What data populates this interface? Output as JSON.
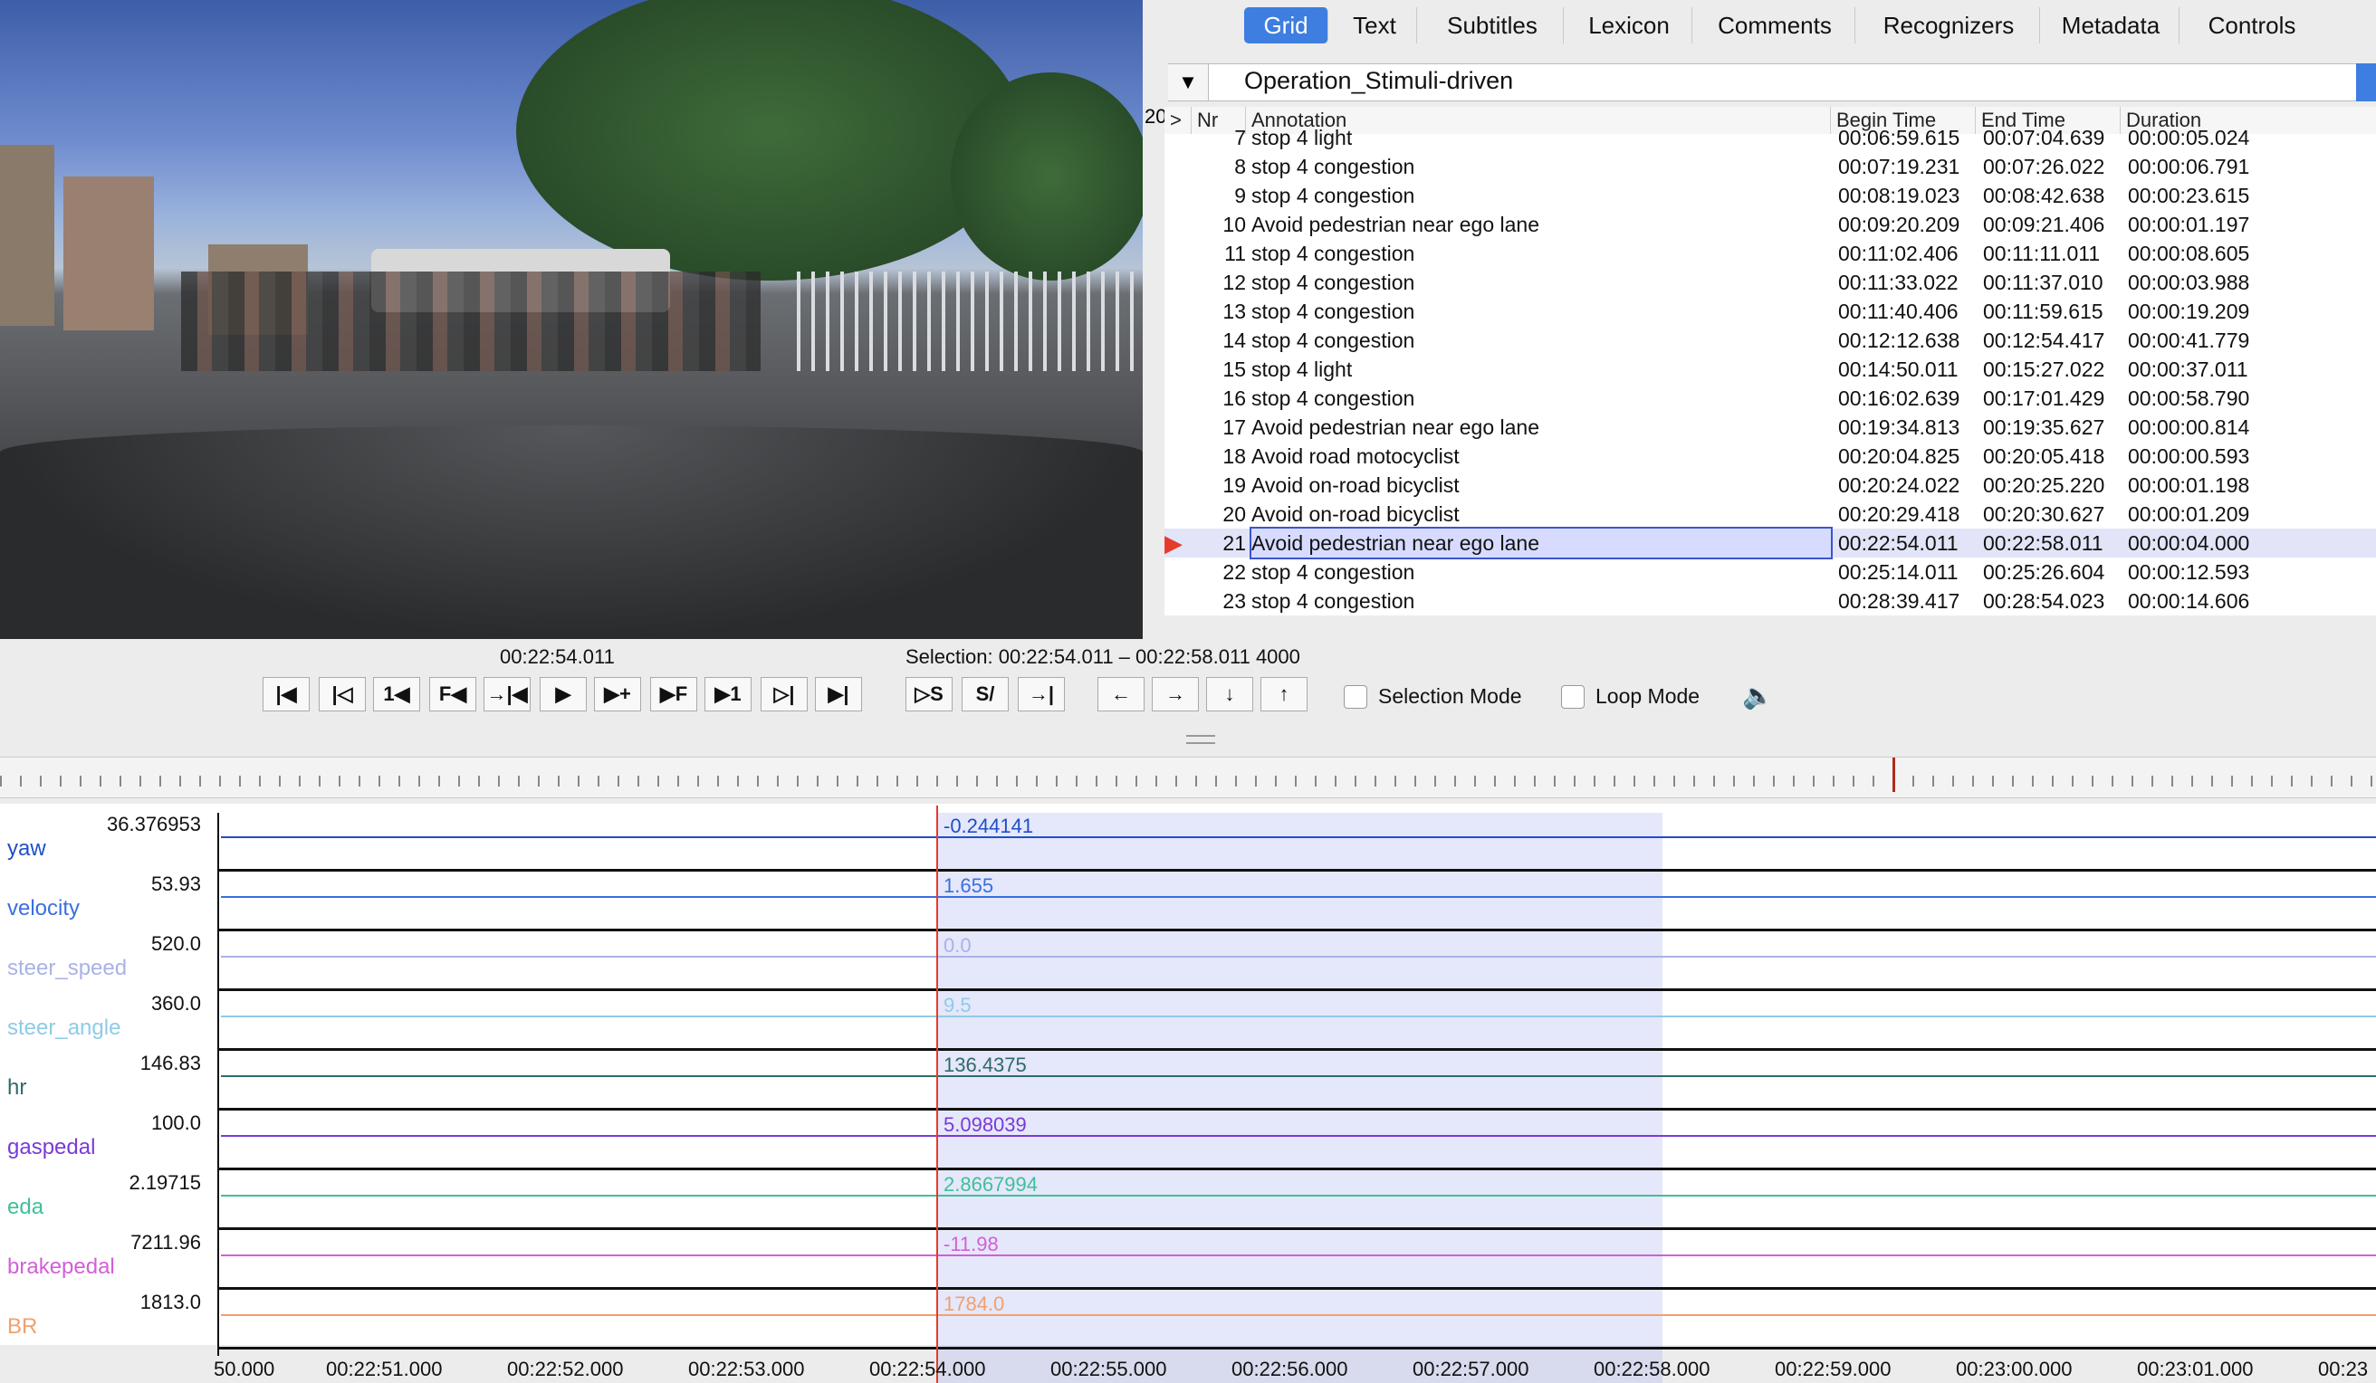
{
  "player": {
    "media_time": "00:22:54.011",
    "selection": "Selection: 00:22:54.011 – 00:22:58.011  4000",
    "selection_mode_label": "Selection Mode",
    "loop_mode_label": "Loop Mode",
    "buttons": [
      "|◀",
      "|◁",
      "1◀",
      "F◀",
      "→|◀",
      "▶",
      "▶+",
      "▶F",
      "▶1",
      "▷|",
      "▶|",
      "▷S",
      "S/",
      "→|",
      "←",
      "→",
      "↓",
      "↑"
    ]
  },
  "tabs": [
    "Grid",
    "Text",
    "Subtitles",
    "Lexicon",
    "Comments",
    "Recognizers",
    "Metadata",
    "Controls"
  ],
  "tier": {
    "name": "Operation_Stimuli-driven",
    "dropdown_icon": "triangle-down"
  },
  "grid": {
    "side_label": "20",
    "columns": [
      ">",
      "Nr",
      "Annotation",
      "Begin Time",
      "End Time",
      "Duration"
    ],
    "rows": [
      {
        "nr": "7",
        "annotation": "stop 4 light",
        "begin": "00:06:59.615",
        "end": "00:07:04.639",
        "duration": "00:00:05.024"
      },
      {
        "nr": "8",
        "annotation": "stop 4 congestion",
        "begin": "00:07:19.231",
        "end": "00:07:26.022",
        "duration": "00:00:06.791"
      },
      {
        "nr": "9",
        "annotation": "stop 4 congestion",
        "begin": "00:08:19.023",
        "end": "00:08:42.638",
        "duration": "00:00:23.615"
      },
      {
        "nr": "10",
        "annotation": "Avoid pedestrian near ego lane",
        "begin": "00:09:20.209",
        "end": "00:09:21.406",
        "duration": "00:00:01.197"
      },
      {
        "nr": "11",
        "annotation": "stop 4 congestion",
        "begin": "00:11:02.406",
        "end": "00:11:11.011",
        "duration": "00:00:08.605"
      },
      {
        "nr": "12",
        "annotation": "stop 4 congestion",
        "begin": "00:11:33.022",
        "end": "00:11:37.010",
        "duration": "00:00:03.988"
      },
      {
        "nr": "13",
        "annotation": "stop 4 congestion",
        "begin": "00:11:40.406",
        "end": "00:11:59.615",
        "duration": "00:00:19.209"
      },
      {
        "nr": "14",
        "annotation": "stop 4 congestion",
        "begin": "00:12:12.638",
        "end": "00:12:54.417",
        "duration": "00:00:41.779"
      },
      {
        "nr": "15",
        "annotation": "stop 4 light",
        "begin": "00:14:50.011",
        "end": "00:15:27.022",
        "duration": "00:00:37.011"
      },
      {
        "nr": "16",
        "annotation": "stop 4 congestion",
        "begin": "00:16:02.639",
        "end": "00:17:01.429",
        "duration": "00:00:58.790"
      },
      {
        "nr": "17",
        "annotation": "Avoid pedestrian near ego lane",
        "begin": "00:19:34.813",
        "end": "00:19:35.627",
        "duration": "00:00:00.814"
      },
      {
        "nr": "18",
        "annotation": "Avoid road motocyclist",
        "begin": "00:20:04.825",
        "end": "00:20:05.418",
        "duration": "00:00:00.593"
      },
      {
        "nr": "19",
        "annotation": "Avoid on-road bicyclist",
        "begin": "00:20:24.022",
        "end": "00:20:25.220",
        "duration": "00:00:01.198"
      },
      {
        "nr": "20",
        "annotation": "Avoid on-road bicyclist",
        "begin": "00:20:29.418",
        "end": "00:20:30.627",
        "duration": "00:00:01.209"
      },
      {
        "nr": "21",
        "annotation": "Avoid pedestrian near ego lane",
        "begin": "00:22:54.011",
        "end": "00:22:58.011",
        "duration": "00:00:04.000",
        "selected": true
      },
      {
        "nr": "22",
        "annotation": "stop 4 congestion",
        "begin": "00:25:14.011",
        "end": "00:25:26.604",
        "duration": "00:00:12.593"
      },
      {
        "nr": "23",
        "annotation": "stop 4 congestion",
        "begin": "00:28:39.417",
        "end": "00:28:54.023",
        "duration": "00:00:14.606"
      }
    ]
  },
  "tracks": [
    {
      "name": "yaw",
      "max": "36.376953",
      "value": "-0.244141",
      "color": "#1f4fc8"
    },
    {
      "name": "velocity",
      "max": "53.93",
      "value": "1.655",
      "color": "#3a6fe0"
    },
    {
      "name": "steer_speed",
      "max": "520.0",
      "value": "0.0",
      "color": "#a9b2e6"
    },
    {
      "name": "steer_angle",
      "max": "360.0",
      "value": "9.5",
      "color": "#8ecbe8"
    },
    {
      "name": "hr",
      "max": "146.83",
      "value": "136.4375",
      "color": "#2e6b6a"
    },
    {
      "name": "gaspedal",
      "max": "100.0",
      "value": "5.098039",
      "color": "#7a3ad8"
    },
    {
      "name": "eda",
      "max": "2.19715",
      "value": "2.8667994",
      "color": "#3fbf9a"
    },
    {
      "name": "brakepedal",
      "max": "7211.96",
      "value": "-11.98",
      "color": "#d25fd8"
    },
    {
      "name": "BR",
      "max": "1813.0",
      "value": "1784.0",
      "color": "#f0a070"
    }
  ],
  "time_axis": [
    "50.000",
    "00:22:51.000",
    "00:22:52.000",
    "00:22:53.000",
    "00:22:54.000",
    "00:22:55.000",
    "00:22:56.000",
    "00:22:57.000",
    "00:22:58.000",
    "00:22:59.000",
    "00:23:00.000",
    "00:23:01.000",
    "00:23"
  ]
}
